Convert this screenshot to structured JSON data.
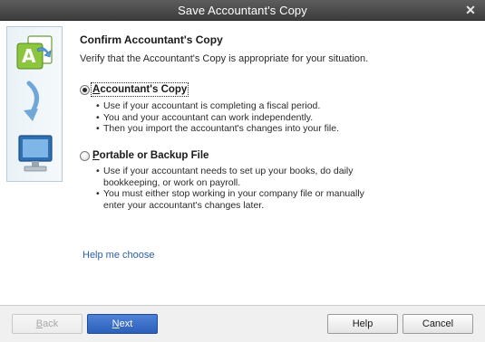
{
  "window": {
    "title": "Save Accountant's Copy"
  },
  "page": {
    "heading": "Confirm Accountant's Copy",
    "subtext": "Verify that the Accountant's Copy is appropriate for your situation."
  },
  "options": [
    {
      "label_accel": "A",
      "label_rest": "ccountant's Copy",
      "selected": true,
      "bullets": [
        "Use if your accountant is completing a fiscal period.",
        "You and your accountant can work independently.",
        "Then you import the accountant's changes into your file."
      ]
    },
    {
      "label_accel": "P",
      "label_rest": "ortable or Backup File",
      "selected": false,
      "bullets": [
        "Use if your accountant needs to set up your books, do daily bookkeeping, or work on payroll.",
        "You must either stop working in your company file or manually enter your accountant's changes later."
      ]
    }
  ],
  "help_link": "Help me choose",
  "buttons": {
    "back_accel": "B",
    "back_rest": "ack",
    "next_accel": "N",
    "next_rest": "ext",
    "help": "Help",
    "cancel": "Cancel"
  },
  "icons": {
    "close": "close-icon",
    "side": [
      "accountant-copy-icon",
      "arrow-curve-icon",
      "monitor-icon"
    ]
  },
  "colors": {
    "accent": "#2c5fba",
    "link": "#2a5db0",
    "titlebar": "#4a4a4a"
  }
}
